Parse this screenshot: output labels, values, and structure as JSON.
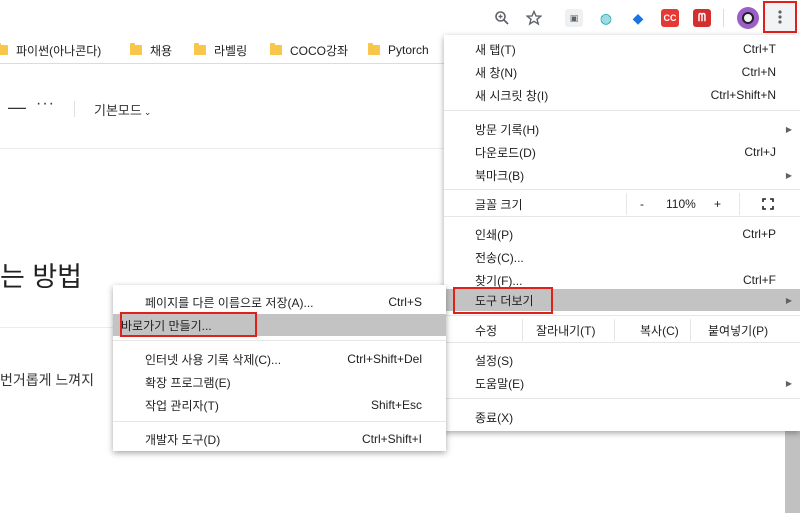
{
  "toolbar": {
    "zoom_icon": "zoom-in-icon",
    "star_icon": "bookmark-star-icon",
    "menu_icon": "kebab-menu-icon",
    "extensions": [
      {
        "name": "cast-extension-icon",
        "color": "#5f6368",
        "glyph": "▣"
      },
      {
        "name": "globe-extension-icon",
        "color": "#13a3b5",
        "glyph": "◍"
      },
      {
        "name": "diamond-extension-icon",
        "color": "#1a73e8",
        "glyph": "◆"
      },
      {
        "name": "cc-extension-icon",
        "color": "#e53935",
        "glyph": "CC"
      },
      {
        "name": "mendeley-extension-icon",
        "color": "#d32f2f",
        "glyph": "ᗰ"
      }
    ]
  },
  "bookmarks": [
    {
      "label": "파이썬(아나콘다)"
    },
    {
      "label": "채용"
    },
    {
      "label": "라벨링"
    },
    {
      "label": "COCO강좌"
    },
    {
      "label": "Pytorch"
    }
  ],
  "page": {
    "mode_label": "기본모드",
    "heading_fragment": "는 방법",
    "body_fragment": "번거롭게 느껴지"
  },
  "menu": {
    "new_tab": {
      "label": "새 탭(T)",
      "shortcut": "Ctrl+T"
    },
    "new_window": {
      "label": "새 창(N)",
      "shortcut": "Ctrl+N"
    },
    "incognito": {
      "label": "새 시크릿 창(I)",
      "shortcut": "Ctrl+Shift+N"
    },
    "history": {
      "label": "방문 기록(H)"
    },
    "downloads": {
      "label": "다운로드(D)",
      "shortcut": "Ctrl+J"
    },
    "bookmarks": {
      "label": "북마크(B)"
    },
    "zoom": {
      "label": "글꼴 크기",
      "minus": "-",
      "value": "110%",
      "plus": "+"
    },
    "print": {
      "label": "인쇄(P)",
      "shortcut": "Ctrl+P"
    },
    "cast": {
      "label": "전송(C)..."
    },
    "find": {
      "label": "찾기(F)...",
      "shortcut": "Ctrl+F"
    },
    "more_tools": {
      "label": "도구 더보기"
    },
    "edit": {
      "label": "수정",
      "cut": "잘라내기(T)",
      "copy": "복사(C)",
      "paste": "붙여넣기(P)"
    },
    "settings": {
      "label": "설정(S)"
    },
    "help": {
      "label": "도움말(E)"
    },
    "exit": {
      "label": "종료(X)"
    }
  },
  "submenu": {
    "save_page": {
      "label": "페이지를 다른 이름으로 저장(A)...",
      "shortcut": "Ctrl+S"
    },
    "create_shortcut": {
      "label": "바로가기 만들기..."
    },
    "clear_data": {
      "label": "인터넷 사용 기록 삭제(C)...",
      "shortcut": "Ctrl+Shift+Del"
    },
    "extensions": {
      "label": "확장 프로그램(E)"
    },
    "task_manager": {
      "label": "작업 관리자(T)",
      "shortcut": "Shift+Esc"
    },
    "dev_tools": {
      "label": "개발자 도구(D)",
      "shortcut": "Ctrl+Shift+I"
    }
  }
}
